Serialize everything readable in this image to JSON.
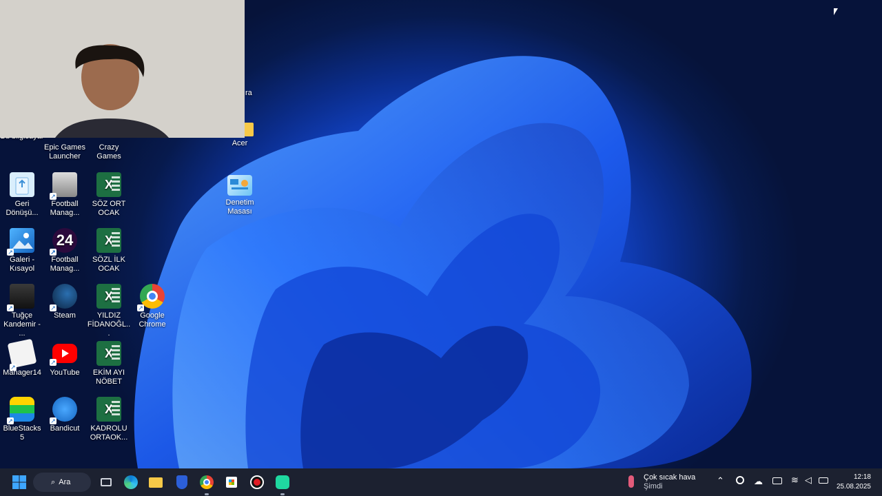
{
  "desktop": {
    "icons": [
      {
        "label": "Bu bilgisayar",
        "icon": "computer-icon"
      },
      {
        "label": "Epic Games Launcher",
        "icon": "epic-games-icon"
      },
      {
        "label": "Crazy Games",
        "icon": "crazy-games-icon"
      },
      {
        "label": "Acer",
        "icon": "folder-icon"
      },
      {
        "label": "Geri Dönüşü...",
        "icon": "recycle-bin-icon"
      },
      {
        "label": "Football Manag...",
        "icon": "football-manager-icon"
      },
      {
        "label": "SÖZ ORT OCAK",
        "icon": "excel-icon"
      },
      {
        "label": "Denetim Masası",
        "icon": "control-panel-icon"
      },
      {
        "label": "Galeri - Kısayol",
        "icon": "gallery-icon"
      },
      {
        "label": "Football Manag...",
        "icon": "football-manager-24-icon"
      },
      {
        "label": "SÖZL İLK OCAK",
        "icon": "excel-icon"
      },
      {
        "label": "Tuğçe Kandemir - ...",
        "icon": "video-thumbnail-icon"
      },
      {
        "label": "Steam",
        "icon": "steam-icon"
      },
      {
        "label": "YILDIZ FİDANOĞL...",
        "icon": "excel-icon"
      },
      {
        "label": "Google Chrome",
        "icon": "chrome-icon"
      },
      {
        "label": "Manager14",
        "icon": "manager14-icon"
      },
      {
        "label": "YouTube",
        "icon": "youtube-icon"
      },
      {
        "label": "EKİM AYI NÖBET",
        "icon": "excel-icon"
      },
      {
        "label": "BlueStacks 5",
        "icon": "bluestacks-icon"
      },
      {
        "label": "Bandicut",
        "icon": "bandicut-icon"
      },
      {
        "label": "KADROLU ORTAOK...",
        "icon": "excel-icon"
      }
    ],
    "partial_label": "ra"
  },
  "taskbar": {
    "search_label": "Ara",
    "weather_title": "Çok sıcak hava",
    "weather_sub": "Şimdi",
    "time": "12:18",
    "date": "25.08.2025"
  }
}
